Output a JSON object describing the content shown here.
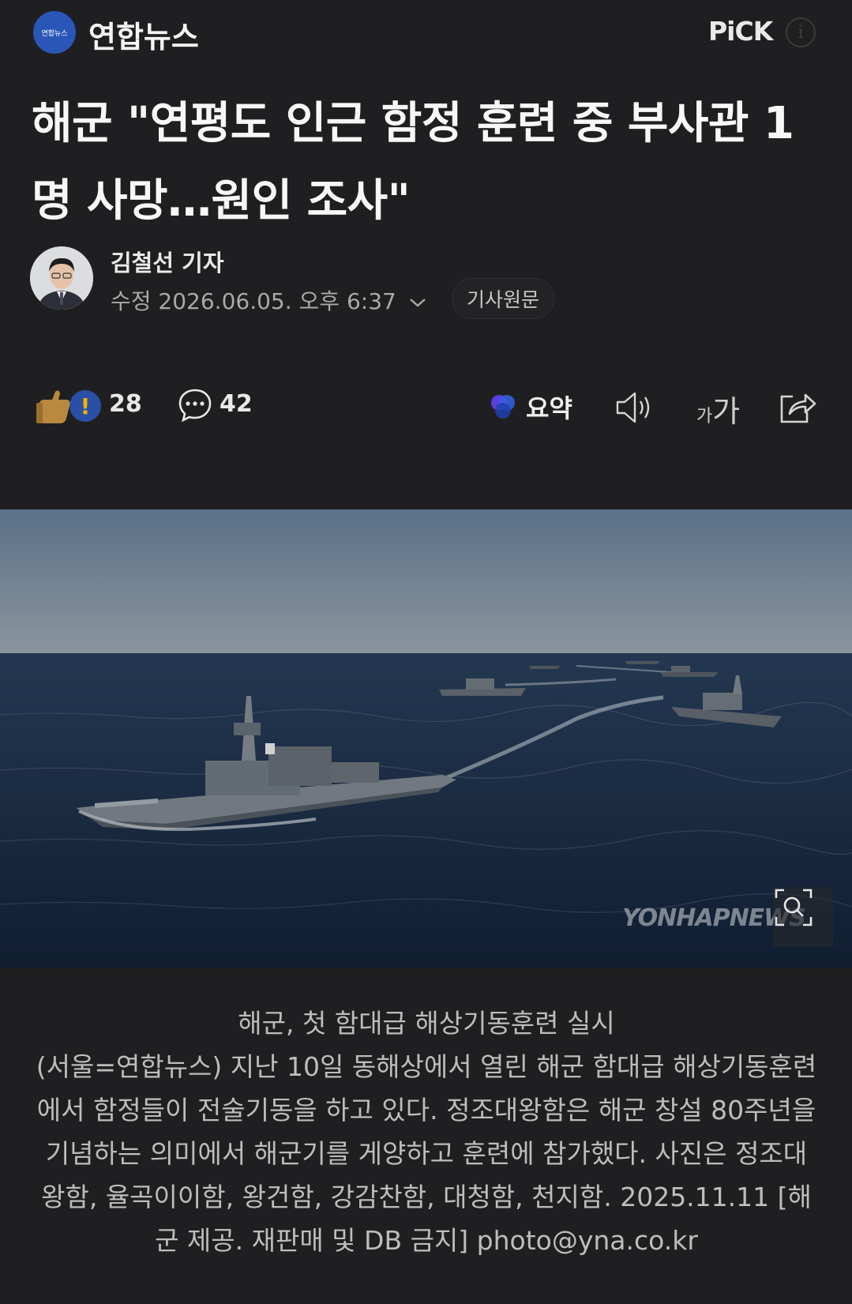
{
  "header": {
    "press_logo_text": "연합뉴스",
    "press_name": "연합뉴스",
    "pick_label": "PiCK",
    "info_label": "i"
  },
  "article": {
    "headline": "해군 \"연평도 인근 함정 훈련 중 부사관 1명 사망…원인 조사\"",
    "reporter": "김철선 기자",
    "modified": "수정 2026.06.05. 오후 6:37",
    "original_link": "기사원문"
  },
  "actions": {
    "reaction_count": "28",
    "comment_count": "42",
    "summary_label": "요약",
    "font_small": "가",
    "font_big": "가"
  },
  "photo": {
    "watermark": "YONHAPNEWS",
    "caption_title": "해군, 첫 함대급 해상기동훈련 실시",
    "caption_body": "(서울=연합뉴스) 지난 10일 동해상에서 열린 해군 함대급 해상기동훈련에서 함정들이 전술기동을 하고 있다. 정조대왕함은 해군 창설 80주년을 기념하는 의미에서 해군기를 게양하고 훈련에 참가했다. 사진은 정조대왕함, 율곡이이함, 왕건함, 강감찬함, 대청함, 천지함. 2025.11.11 [해군 제공. 재판매 및 DB 금지] photo@yna.co.kr"
  },
  "colors": {
    "background": "#1f1f21",
    "press_logo": "#2a56b8",
    "sea": "#1b2d45"
  }
}
